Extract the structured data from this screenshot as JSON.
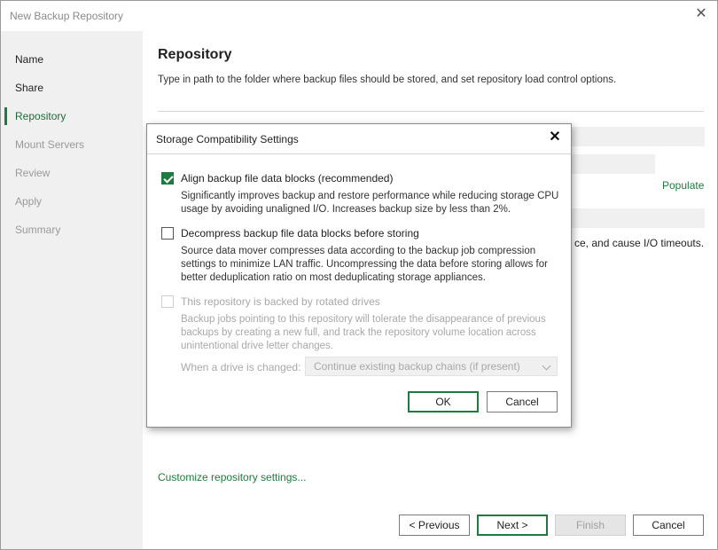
{
  "window": {
    "title": "New Backup Repository"
  },
  "sidebar": {
    "items": [
      {
        "label": "Name"
      },
      {
        "label": "Share"
      },
      {
        "label": "Repository"
      },
      {
        "label": "Mount Servers"
      },
      {
        "label": "Review"
      },
      {
        "label": "Apply"
      },
      {
        "label": "Summary"
      }
    ]
  },
  "main": {
    "heading": "Repository",
    "description": "Type in path to the folder where backup files should be stored, and set repository load control options.",
    "populate_link": "Populate",
    "background_text": "ce, and cause I/O timeouts.",
    "customize_link": "Customize repository settings..."
  },
  "footer": {
    "previous": "< Previous",
    "next": "Next >",
    "finish": "Finish",
    "cancel": "Cancel"
  },
  "dialog": {
    "title": "Storage Compatibility Settings",
    "options": [
      {
        "label": "Align backup file data blocks (recommended)",
        "checked": true,
        "enabled": true,
        "description": "Significantly improves backup and restore performance while reducing storage CPU usage by avoiding unaligned I/O. Increases backup size by less than 2%."
      },
      {
        "label": "Decompress backup file data blocks before storing",
        "checked": false,
        "enabled": true,
        "description": "Source data mover compresses data according to the backup job compression settings to minimize LAN traffic. Uncompressing the data before storing allows for better deduplication ratio on most deduplicating storage appliances."
      },
      {
        "label": "This repository is backed by rotated drives",
        "checked": false,
        "enabled": false,
        "description": "Backup jobs pointing to this repository will tolerate the disappearance of previous backups by creating a new full, and track the repository volume location across unintentional drive letter changes."
      }
    ],
    "drive_change_label": "When a drive is changed:",
    "drive_change_value": "Continue existing backup chains (if present)",
    "ok": "OK",
    "cancel": "Cancel"
  },
  "colors": {
    "accent": "#1e7a3e",
    "sidebar_bg": "#f0f0f0"
  }
}
